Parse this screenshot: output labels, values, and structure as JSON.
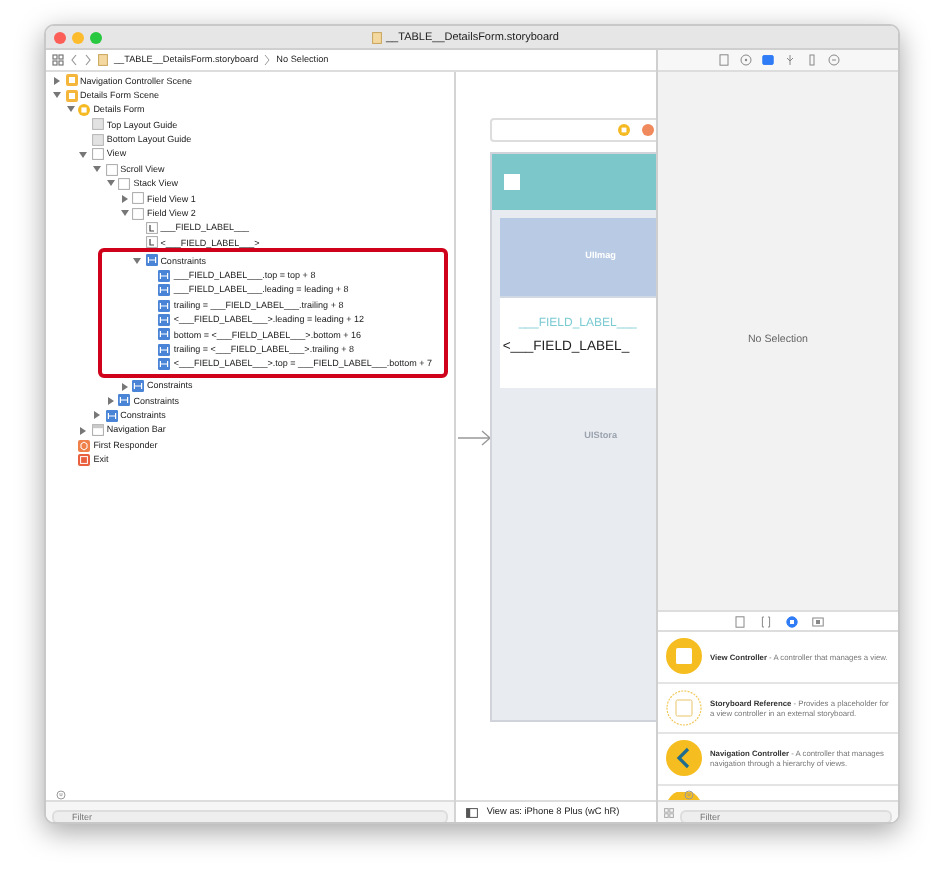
{
  "window": {
    "title": "__TABLE__DetailsForm.storyboard"
  },
  "path_bar": {
    "file": "__TABLE__DetailsForm.storyboard",
    "selection": "No Selection"
  },
  "outline": {
    "items": [
      {
        "label": "Navigation Controller Scene",
        "kind": "scene",
        "expanded": false
      },
      {
        "label": "Details Form Scene",
        "kind": "scene",
        "expanded": true,
        "children": [
          {
            "label": "Details Form",
            "kind": "controller",
            "expanded": true,
            "children": [
              {
                "label": "Top Layout Guide",
                "kind": "guide"
              },
              {
                "label": "Bottom Layout Guide",
                "kind": "guide"
              },
              {
                "label": "View",
                "kind": "view",
                "expanded": true,
                "children": [
                  {
                    "label": "Scroll View",
                    "kind": "view",
                    "expanded": true,
                    "children": [
                      {
                        "label": "Stack View",
                        "kind": "view",
                        "expanded": true,
                        "children": [
                          {
                            "label": "Field View 1",
                            "kind": "view",
                            "expanded": false
                          },
                          {
                            "label": "Field View 2",
                            "kind": "view",
                            "expanded": true,
                            "children": [
                              {
                                "label": "___FIELD_LABEL___",
                                "kind": "label"
                              },
                              {
                                "label": "<___FIELD_LABEL___>",
                                "kind": "label"
                              },
                              {
                                "label": "Constraints",
                                "kind": "constraint",
                                "expanded": true,
                                "highlighted": true,
                                "children": [
                                  {
                                    "label": "___FIELD_LABEL___.top = top + 8",
                                    "kind": "constraint"
                                  },
                                  {
                                    "label": "___FIELD_LABEL___.leading = leading + 8",
                                    "kind": "constraint"
                                  },
                                  {
                                    "label": "trailing = ___FIELD_LABEL___.trailing + 8",
                                    "kind": "constraint"
                                  },
                                  {
                                    "label": "<___FIELD_LABEL___>.leading = leading + 12",
                                    "kind": "constraint"
                                  },
                                  {
                                    "label": "bottom = <___FIELD_LABEL___>.bottom + 16",
                                    "kind": "constraint"
                                  },
                                  {
                                    "label": "trailing = <___FIELD_LABEL___>.trailing + 8",
                                    "kind": "constraint"
                                  },
                                  {
                                    "label": "<___FIELD_LABEL___>.top = ___FIELD_LABEL___.bottom + 7",
                                    "kind": "constraint"
                                  }
                                ]
                              }
                            ]
                          },
                          {
                            "label": "Constraints",
                            "kind": "constraint",
                            "expanded": false
                          }
                        ]
                      },
                      {
                        "label": "Constraints",
                        "kind": "constraint",
                        "expanded": false
                      }
                    ]
                  },
                  {
                    "label": "Constraints",
                    "kind": "constraint",
                    "expanded": false
                  }
                ]
              },
              {
                "label": "Navigation Bar",
                "kind": "navbar",
                "expanded": false
              }
            ]
          },
          {
            "label": "First Responder",
            "kind": "responder"
          },
          {
            "label": "Exit",
            "kind": "exit"
          }
        ]
      }
    ],
    "filter": {
      "placeholder": "Filter"
    }
  },
  "canvas": {
    "image_placeholder": "UIImag",
    "field_label": "___FIELD_LABEL___",
    "field_value": "<___FIELD_LABEL_",
    "lower_placeholder": "UIStora",
    "view_as": "View as: iPhone 8 Plus (wC hR)"
  },
  "inspector": {
    "tabs": [
      {
        "kind": "file",
        "selected": false
      },
      {
        "kind": "help",
        "selected": false
      },
      {
        "kind": "identity",
        "selected": true
      },
      {
        "kind": "attributes",
        "selected": false
      },
      {
        "kind": "size",
        "selected": false
      },
      {
        "kind": "connections",
        "selected": false
      }
    ],
    "message": "No Selection"
  },
  "library": {
    "tabs": [
      {
        "kind": "file",
        "selected": false
      },
      {
        "kind": "braces",
        "selected": false
      },
      {
        "kind": "object",
        "selected": true
      },
      {
        "kind": "media",
        "selected": false
      }
    ],
    "items": [
      {
        "kind": "view-controller",
        "description": "**View Controller** - A controller that manages a view."
      },
      {
        "kind": "storyboard-reference",
        "description": "**Storyboard Reference** - Provides a placeholder for a view controller in an external storyboard."
      },
      {
        "kind": "navigation-controller",
        "description": "**Navigation Controller** - A controller that manages navigation through a hierarchy of views."
      },
      {
        "kind": "cut"
      }
    ],
    "filter": {
      "placeholder": "Filter"
    }
  }
}
